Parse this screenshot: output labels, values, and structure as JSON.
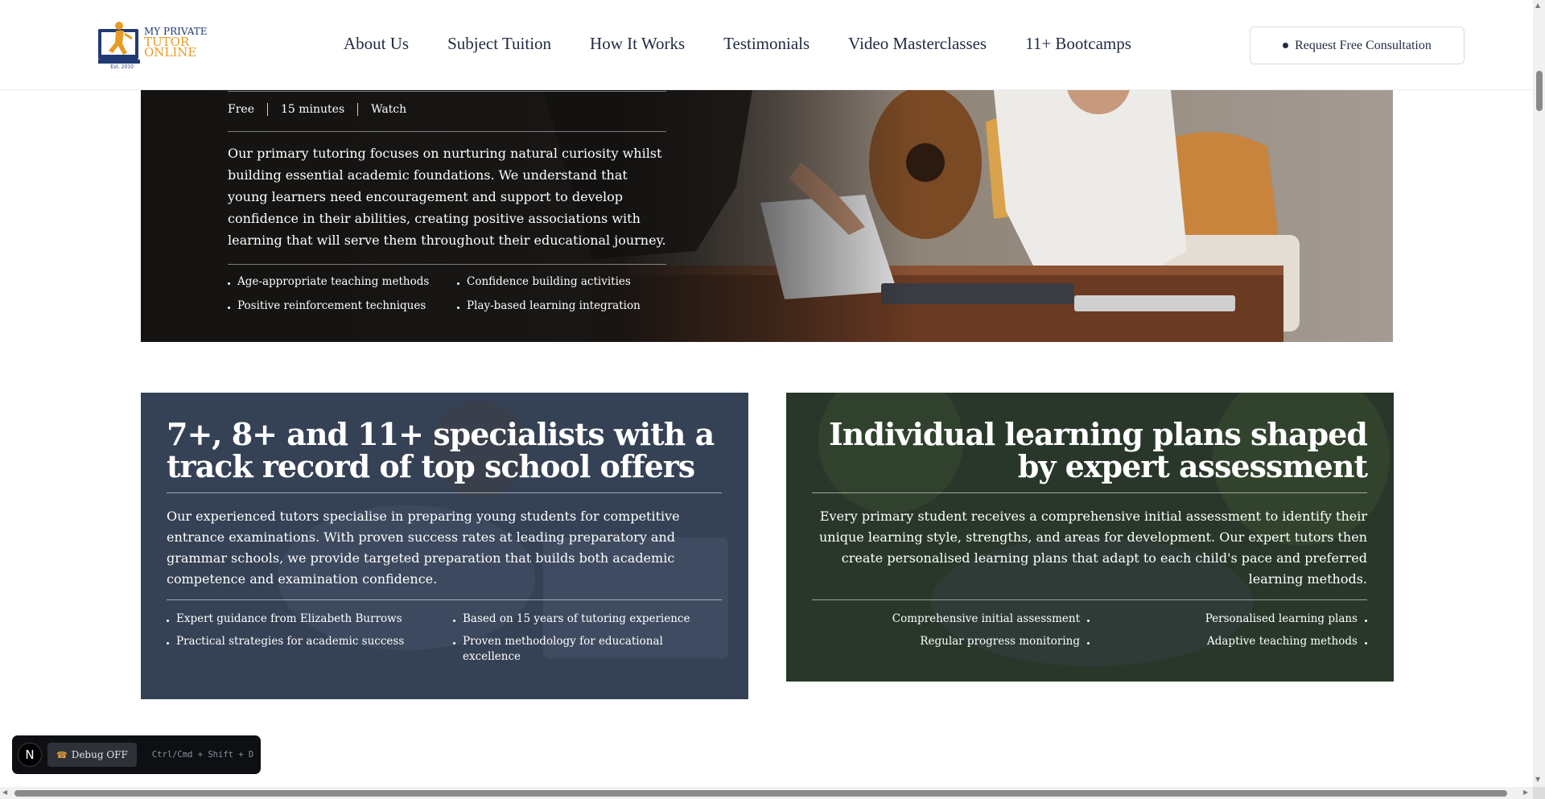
{
  "header": {
    "logo_line1": "MY PRIVATE",
    "logo_line2": "TUTOR",
    "logo_line3": "ONLINE",
    "logo_est": "Est. 2010",
    "nav": [
      "About Us",
      "Subject Tuition",
      "How It Works",
      "Testimonials",
      "Video Masterclasses",
      "11+ Bootcamps"
    ],
    "cta_label": "Request Free Consultation"
  },
  "hero": {
    "meta": [
      "Free",
      "15 minutes",
      "Watch"
    ],
    "description": "Our primary tutoring focuses on nurturing natural curiosity whilst building essential academic foundations. We understand that young learners need encouragement and support to develop confidence in their abilities, creating positive associations with learning that will serve them throughout their educational journey.",
    "features": [
      "Age-appropriate teaching methods",
      "Confidence building activities",
      "Positive reinforcement techniques",
      "Play-based learning integration"
    ]
  },
  "card_left": {
    "title": "7+, 8+ and 11+ specialists with a track record of top school offers",
    "description": "Our experienced tutors specialise in preparing young students for competitive entrance examinations. With proven success rates at leading preparatory and grammar schools, we provide targeted preparation that builds both academic competence and examination confidence.",
    "features": [
      "Expert guidance from Elizabeth Burrows",
      "Based on 15 years of tutoring experience",
      "Practical strategies for academic success",
      "Proven methodology for educational excellence"
    ]
  },
  "card_right": {
    "title": "Individual learning plans shaped by expert assessment",
    "description": "Every primary student receives a comprehensive initial assessment to identify their unique learning style, strengths, and areas for development. Our expert tutors then create personalised learning plans that adapt to each child's pace and preferred learning methods.",
    "features": [
      "Comprehensive initial assessment",
      "Personalised learning plans",
      "Regular progress monitoring",
      "Adaptive teaching methods"
    ]
  },
  "debug": {
    "badge": "N",
    "button_label": "Debug OFF",
    "shortcut": "Ctrl/Cmd + Shift + D"
  },
  "colors": {
    "navy": "#1f2a44",
    "accent_orange": "#e79b22",
    "logo_blue": "#223a74"
  }
}
